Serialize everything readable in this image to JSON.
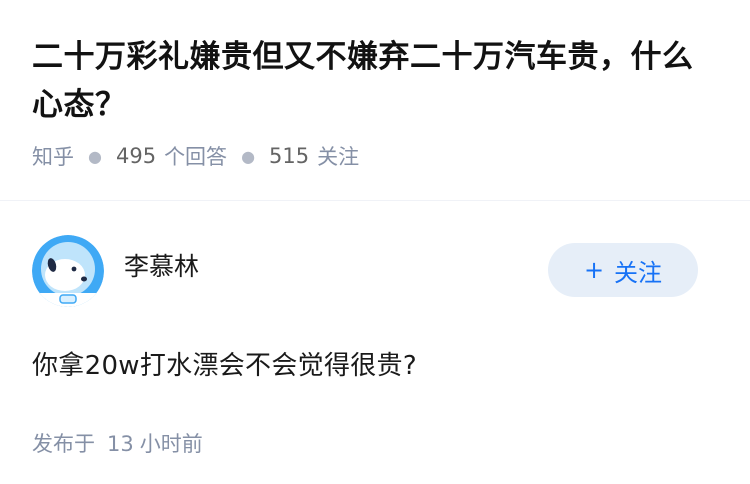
{
  "question": {
    "title": "二十万彩礼嫌贵但又不嫌弃二十万汽车贵，什么心态？",
    "source": "知乎",
    "answer_count": "495",
    "answer_label": "个回答",
    "follower_count": "515",
    "follower_label": "关注"
  },
  "answer": {
    "author_name": "李慕林",
    "follow_label": "关注",
    "content": "你拿20w打水漂会不会觉得很贵?",
    "published_prefix": "发布于",
    "published_num": "13",
    "published_suffix": "小时前"
  },
  "colors": {
    "accent": "#1772f6",
    "follow_bg": "#e6eef8",
    "meta": "#8590a6"
  }
}
